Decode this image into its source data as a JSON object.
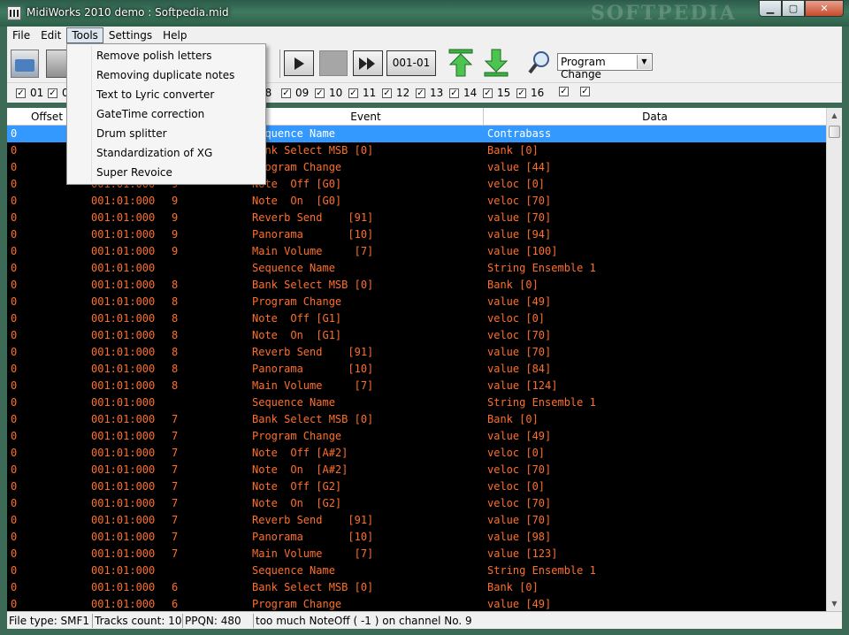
{
  "window": {
    "title": "MidiWorks 2010 demo : Softpedia.mid",
    "watermark": "SOFTPEDIA",
    "caption_minimize": "▁",
    "caption_maximize": "▢",
    "caption_close": "✕"
  },
  "menubar": {
    "items": [
      "File",
      "Edit",
      "Tools",
      "Settings",
      "Help"
    ],
    "open_item": "Tools"
  },
  "tools_menu": {
    "items": [
      "Remove polish letters",
      "Removing duplicate notes",
      "Text to Lyric converter",
      "GateTime correction",
      "Drum splitter",
      "Standardization of XG",
      "Super Revoice"
    ]
  },
  "toolbar": {
    "counter": "001-01",
    "event_filter": "Program Change",
    "icons": [
      "open-folder-icon",
      "save-disk-icon",
      "play-icon",
      "stop-icon",
      "fast-forward-icon",
      "move-up-icon",
      "move-down-icon",
      "search-icon"
    ]
  },
  "channels": {
    "visible_left": [
      "01",
      "0"
    ],
    "visible_right": [
      "08",
      "09",
      "10",
      "11",
      "12",
      "13",
      "14",
      "15",
      "16",
      "",
      ""
    ]
  },
  "table": {
    "columns": [
      "Offset",
      "",
      "",
      "Event",
      "Data"
    ],
    "rows": [
      {
        "offset": "0",
        "time": "",
        "track": "",
        "event": "Sequence Name",
        "data": "Contrabass",
        "selected": true
      },
      {
        "offset": "0",
        "time": "",
        "track": "",
        "event": "Bank Select MSB [0]",
        "data": "Bank [0]"
      },
      {
        "offset": "0",
        "time": "",
        "track": "",
        "event": "Program Change",
        "data": "value [44]"
      },
      {
        "offset": "0",
        "time": "001:01:000",
        "track": "9",
        "event": "Note  Off [G0]",
        "data": "veloc [0]"
      },
      {
        "offset": "0",
        "time": "001:01:000",
        "track": "9",
        "event": "Note  On  [G0]",
        "data": "veloc [70]"
      },
      {
        "offset": "0",
        "time": "001:01:000",
        "track": "9",
        "event": "Reverb Send    [91]",
        "data": "value [70]"
      },
      {
        "offset": "0",
        "time": "001:01:000",
        "track": "9",
        "event": "Panorama       [10]",
        "data": "value [94]"
      },
      {
        "offset": "0",
        "time": "001:01:000",
        "track": "9",
        "event": "Main Volume     [7]",
        "data": "value [100]"
      },
      {
        "offset": "0",
        "time": "001:01:000",
        "track": "",
        "event": "Sequence Name",
        "data": "String Ensemble 1"
      },
      {
        "offset": "0",
        "time": "001:01:000",
        "track": "8",
        "event": "Bank Select MSB [0]",
        "data": "Bank [0]"
      },
      {
        "offset": "0",
        "time": "001:01:000",
        "track": "8",
        "event": "Program Change",
        "data": "value [49]"
      },
      {
        "offset": "0",
        "time": "001:01:000",
        "track": "8",
        "event": "Note  Off [G1]",
        "data": "veloc [0]"
      },
      {
        "offset": "0",
        "time": "001:01:000",
        "track": "8",
        "event": "Note  On  [G1]",
        "data": "veloc [70]"
      },
      {
        "offset": "0",
        "time": "001:01:000",
        "track": "8",
        "event": "Reverb Send    [91]",
        "data": "value [70]"
      },
      {
        "offset": "0",
        "time": "001:01:000",
        "track": "8",
        "event": "Panorama       [10]",
        "data": "value [84]"
      },
      {
        "offset": "0",
        "time": "001:01:000",
        "track": "8",
        "event": "Main Volume     [7]",
        "data": "value [124]"
      },
      {
        "offset": "0",
        "time": "001:01:000",
        "track": "",
        "event": "Sequence Name",
        "data": "String Ensemble 1"
      },
      {
        "offset": "0",
        "time": "001:01:000",
        "track": "7",
        "event": "Bank Select MSB [0]",
        "data": "Bank [0]"
      },
      {
        "offset": "0",
        "time": "001:01:000",
        "track": "7",
        "event": "Program Change",
        "data": "value [49]"
      },
      {
        "offset": "0",
        "time": "001:01:000",
        "track": "7",
        "event": "Note  Off [A#2]",
        "data": "veloc [0]"
      },
      {
        "offset": "0",
        "time": "001:01:000",
        "track": "7",
        "event": "Note  On  [A#2]",
        "data": "veloc [70]"
      },
      {
        "offset": "0",
        "time": "001:01:000",
        "track": "7",
        "event": "Note  Off [G2]",
        "data": "veloc [0]"
      },
      {
        "offset": "0",
        "time": "001:01:000",
        "track": "7",
        "event": "Note  On  [G2]",
        "data": "veloc [70]"
      },
      {
        "offset": "0",
        "time": "001:01:000",
        "track": "7",
        "event": "Reverb Send    [91]",
        "data": "value [70]"
      },
      {
        "offset": "0",
        "time": "001:01:000",
        "track": "7",
        "event": "Panorama       [10]",
        "data": "value [98]"
      },
      {
        "offset": "0",
        "time": "001:01:000",
        "track": "7",
        "event": "Main Volume     [7]",
        "data": "value [123]"
      },
      {
        "offset": "0",
        "time": "001:01:000",
        "track": "",
        "event": "Sequence Name",
        "data": "String Ensemble 1"
      },
      {
        "offset": "0",
        "time": "001:01:000",
        "track": "6",
        "event": "Bank Select MSB [0]",
        "data": "Bank [0]"
      },
      {
        "offset": "0",
        "time": "001:01:000",
        "track": "6",
        "event": "Program Change",
        "data": "value [49]"
      }
    ]
  },
  "statusbar": {
    "file_type": "File type: SMF1",
    "tracks": "Tracks count: 10",
    "ppqn": "PPQN: 480",
    "message": "too much NoteOff ( -1 ) on channel No. 9"
  },
  "colors": {
    "grid_text": "#ff6f2a",
    "grid_bg": "#000000",
    "selection": "#3399ff"
  }
}
